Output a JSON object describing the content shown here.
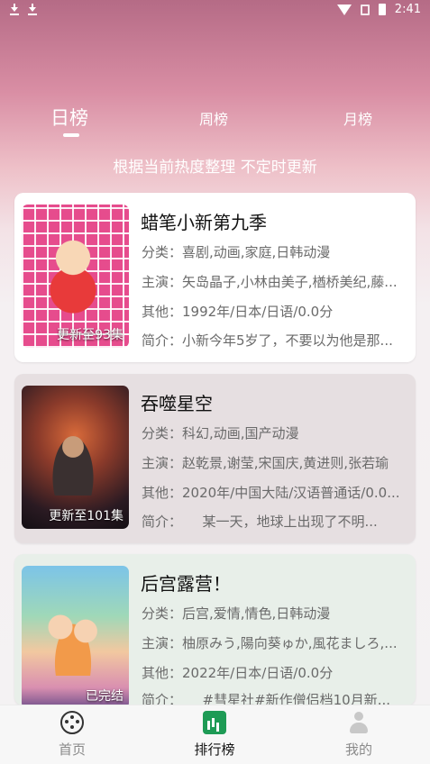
{
  "status_bar": {
    "time": "2:41"
  },
  "tabs": [
    {
      "label": "日榜",
      "active": true
    },
    {
      "label": "周榜",
      "active": false
    },
    {
      "label": "月榜",
      "active": false
    }
  ],
  "subtitle": "根据当前热度整理 不定时更新",
  "items": [
    {
      "title": "蜡笔小新第九季",
      "badge": "更新至93集",
      "category": "分类：喜剧,动画,家庭,日韩动漫",
      "cast": "主演：矢岛晶子,小林由美子,楢桥美纪,藤...",
      "other": "其他：1992年/日本/日语/0.0分",
      "summary": "简介：小新今年5岁了，不要以为他是那..."
    },
    {
      "title": "吞噬星空",
      "badge": "更新至101集",
      "category": "分类：科幻,动画,国产动漫",
      "cast": "主演：赵乾景,谢莹,宋国庆,黄进则,张若瑜",
      "other": "其他：2020年/中国大陆/汉语普通话/0.0...",
      "summary": "简介：　　某一天，地球上出现了不明..."
    },
    {
      "title": "后宫露营！",
      "badge": "已完结",
      "category": "分类：后宫,爱情,情色,日韩动漫",
      "cast": "主演：柚原みう,陽向葵ゅか,風花ましろ,...",
      "other": "其他：2022年/日本/日语/0.0分",
      "summary": "简介：　　#彗星社#新作僧侣档10月新..."
    }
  ],
  "bottom_nav": [
    {
      "label": "首页",
      "icon": "film-reel-icon",
      "active": false
    },
    {
      "label": "排行榜",
      "icon": "chart-icon",
      "active": true
    },
    {
      "label": "我的",
      "icon": "person-icon",
      "active": false
    }
  ]
}
